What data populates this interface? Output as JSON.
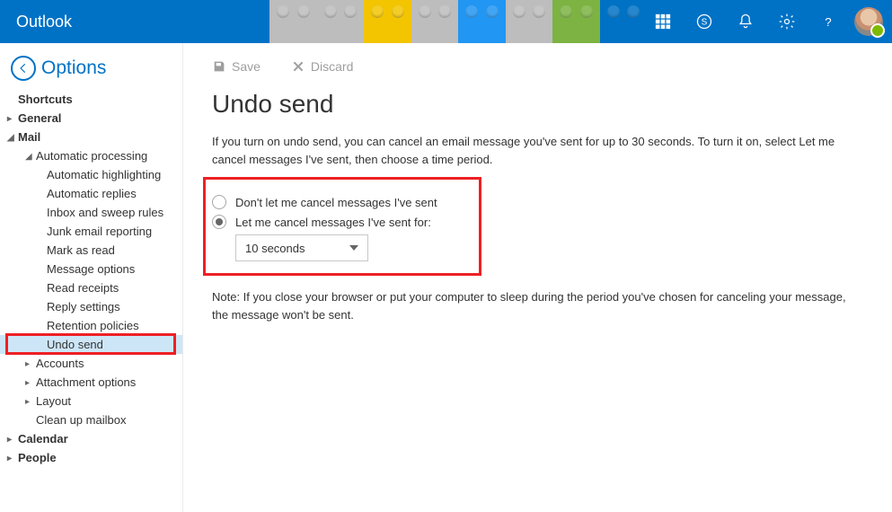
{
  "header": {
    "app_title": "Outlook"
  },
  "back": {
    "title": "Options"
  },
  "sidebar": {
    "shortcuts": "Shortcuts",
    "general": "General",
    "mail": "Mail",
    "auto_processing": "Automatic processing",
    "items": [
      "Automatic highlighting",
      "Automatic replies",
      "Inbox and sweep rules",
      "Junk email reporting",
      "Mark as read",
      "Message options",
      "Read receipts",
      "Reply settings",
      "Retention policies",
      "Undo send"
    ],
    "accounts": "Accounts",
    "attachment": "Attachment options",
    "layout": "Layout",
    "cleanup": "Clean up mailbox",
    "calendar": "Calendar",
    "people": "People"
  },
  "toolbar": {
    "save": "Save",
    "discard": "Discard"
  },
  "page": {
    "title": "Undo send",
    "desc": "If you turn on undo send, you can cancel an email message you've sent for up to 30 seconds. To turn it on, select Let me cancel messages I've sent, then choose a time period.",
    "radio1": "Don't let me cancel messages I've sent",
    "radio2": "Let me cancel messages I've sent for:",
    "select_value": "10 seconds",
    "note": "Note: If you close your browser or put your computer to sleep during the period you've chosen for canceling your message, the message won't be sent."
  }
}
